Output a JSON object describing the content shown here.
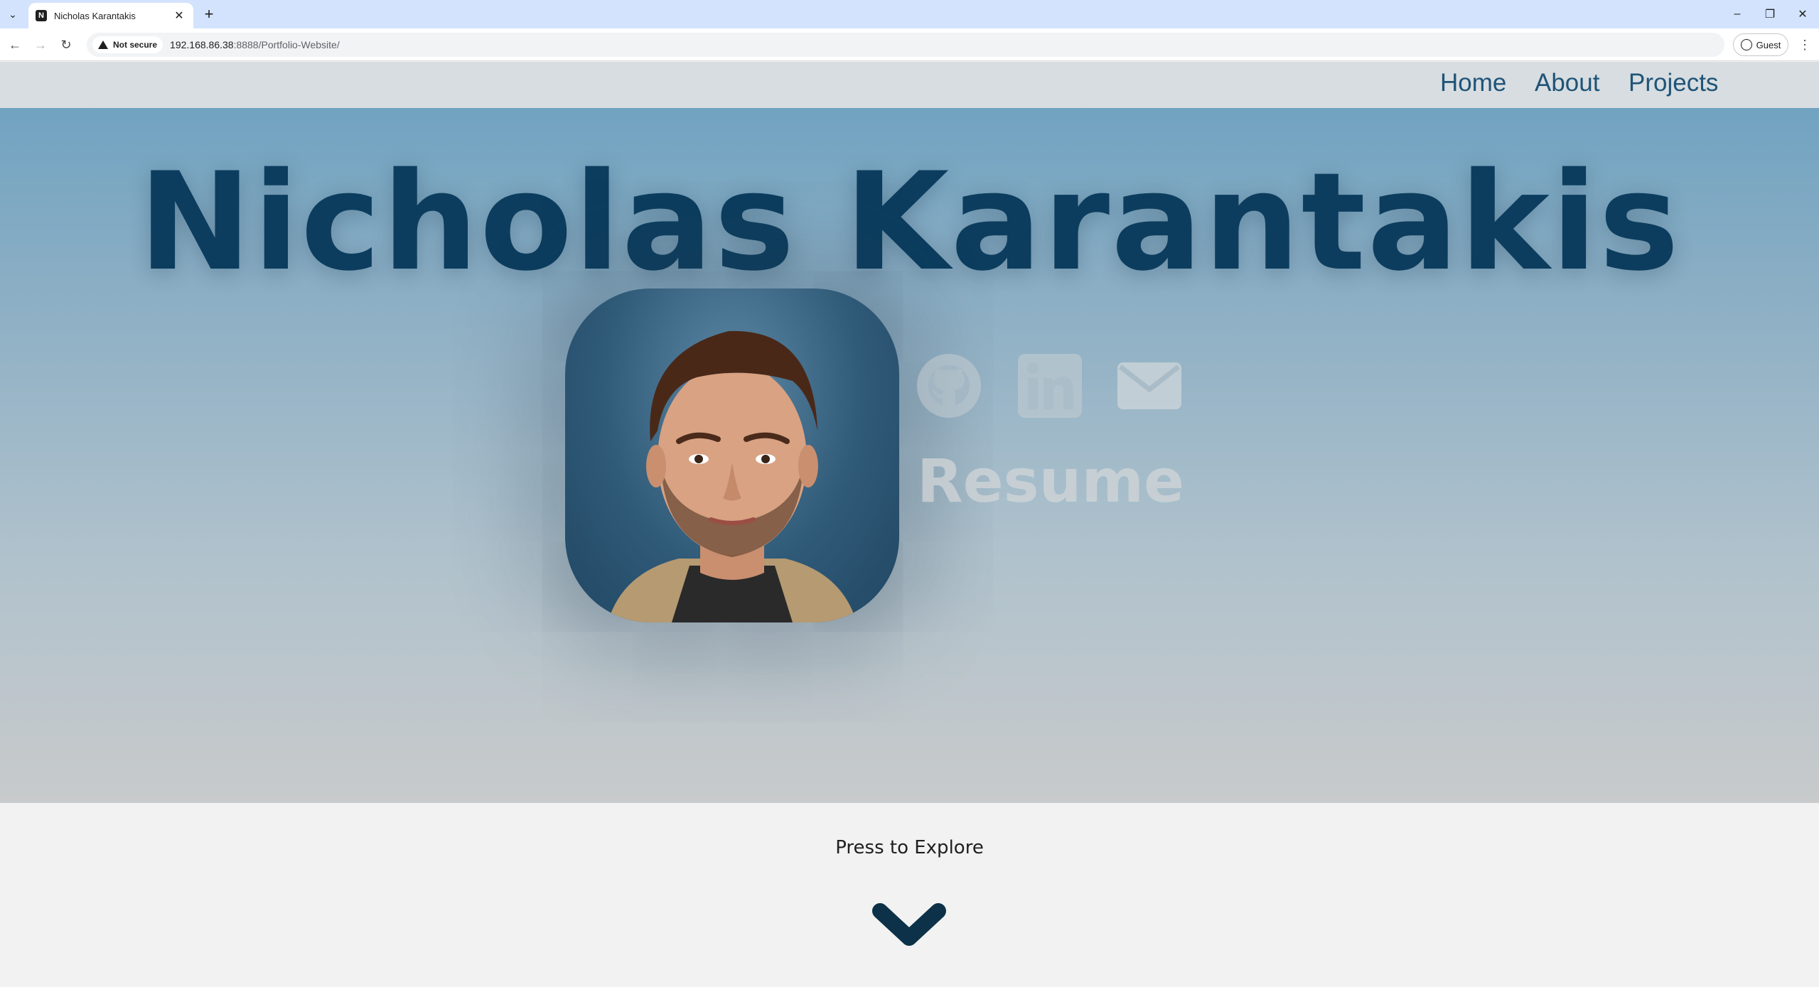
{
  "browser": {
    "tab_title": "Nicholas Karantakis",
    "tab_favicon": "N",
    "security_label": "Not secure",
    "url_host": "192.168.86.38",
    "url_rest": ":8888/Portfolio-Website/",
    "profile_label": "Guest"
  },
  "nav": {
    "home": "Home",
    "about": "About",
    "projects": "Projects"
  },
  "hero": {
    "title": "Nicholas Karantakis",
    "resume": "Resume",
    "social_icons": [
      "github-icon",
      "linkedin-icon",
      "email-icon"
    ]
  },
  "footer": {
    "explore": "Press to Explore"
  },
  "colors": {
    "title": "#0c3d5e",
    "nav_link": "#1f5478",
    "chevron": "#0c3148"
  }
}
